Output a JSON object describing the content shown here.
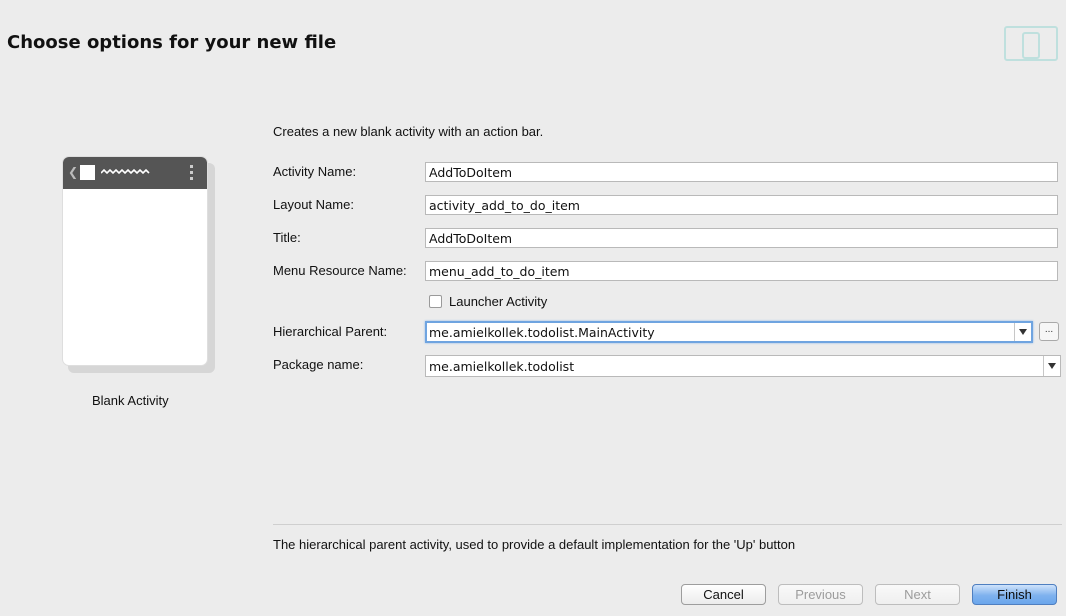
{
  "dialog": {
    "title": "Choose options for your new file"
  },
  "template": {
    "label": "Blank Activity",
    "icon": "device-layout-icon"
  },
  "form": {
    "description": "Creates a new blank activity with an action bar.",
    "activity_name": {
      "label": "Activity Name:",
      "value": "AddToDoItem"
    },
    "layout_name": {
      "label": "Layout Name:",
      "value": "activity_add_to_do_item"
    },
    "title": {
      "label": "Title:",
      "value": "AddToDoItem"
    },
    "menu_resource_name": {
      "label": "Menu Resource Name:",
      "value": "menu_add_to_do_item"
    },
    "launcher_activity": {
      "label": "Launcher Activity",
      "checked": false
    },
    "hierarchical_parent": {
      "label": "Hierarchical Parent:",
      "value": "me.amielkollek.todolist.MainActivity",
      "browse_label": "..."
    },
    "package_name": {
      "label": "Package name:",
      "value": "me.amielkollek.todolist"
    }
  },
  "help_text": "The hierarchical parent activity, used to provide a default implementation for the 'Up' button",
  "buttons": {
    "cancel": "Cancel",
    "previous": "Previous",
    "next": "Next",
    "finish": "Finish"
  },
  "colors": {
    "accent": "#6fa4e0",
    "primary_button": "#7fb2ee",
    "phone_bar": "#555555"
  }
}
